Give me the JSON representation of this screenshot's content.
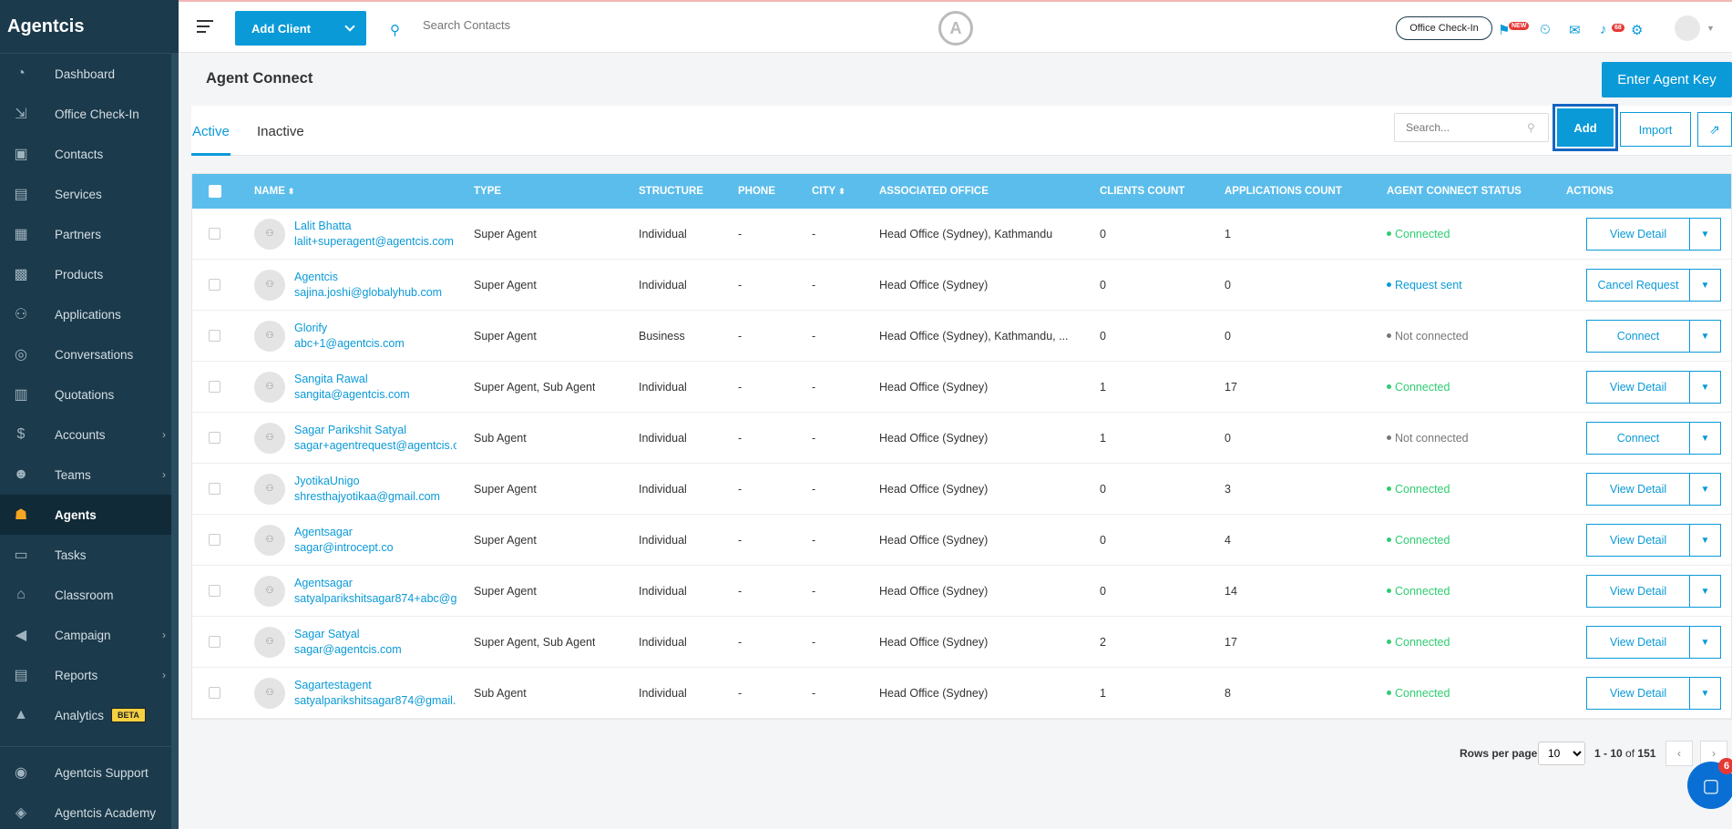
{
  "app": {
    "brand": "Agentcis"
  },
  "sidebar": {
    "items": [
      {
        "label": "Dashboard",
        "icon": "gauge-icon",
        "glyph": "◔"
      },
      {
        "label": "Office Check-In",
        "icon": "checkin-icon",
        "glyph": "⇲"
      },
      {
        "label": "Contacts",
        "icon": "contacts-icon",
        "glyph": "▣"
      },
      {
        "label": "Services",
        "icon": "services-icon",
        "glyph": "▤"
      },
      {
        "label": "Partners",
        "icon": "partners-icon",
        "glyph": "▦"
      },
      {
        "label": "Products",
        "icon": "products-icon",
        "glyph": "▩"
      },
      {
        "label": "Applications",
        "icon": "applications-icon",
        "glyph": "⚇"
      },
      {
        "label": "Conversations",
        "icon": "conversations-icon",
        "glyph": "◎"
      },
      {
        "label": "Quotations",
        "icon": "quotations-icon",
        "glyph": "▥"
      },
      {
        "label": "Accounts",
        "icon": "accounts-icon",
        "glyph": "$",
        "chevron": "›"
      },
      {
        "label": "Teams",
        "icon": "teams-icon",
        "glyph": "☻",
        "chevron": "›"
      },
      {
        "label": "Agents",
        "icon": "agents-icon",
        "glyph": "☗",
        "active": true
      },
      {
        "label": "Tasks",
        "icon": "tasks-icon",
        "glyph": "▭"
      },
      {
        "label": "Classroom",
        "icon": "classroom-icon",
        "glyph": "⌂"
      },
      {
        "label": "Campaign",
        "icon": "campaign-icon",
        "glyph": "◀",
        "chevron": "›"
      },
      {
        "label": "Reports",
        "icon": "reports-icon",
        "glyph": "▤",
        "chevron": "›"
      },
      {
        "label": "Analytics",
        "icon": "analytics-icon",
        "glyph": "▲",
        "badge": "BETA"
      }
    ],
    "bottom": [
      {
        "label": "Agentcis Support",
        "icon": "support-icon",
        "glyph": "◉"
      },
      {
        "label": "Agentcis Academy",
        "icon": "academy-icon",
        "glyph": "◈"
      }
    ]
  },
  "topbar": {
    "add_client": "Add Client",
    "search_placeholder": "Search Contacts",
    "office_checkin": "Office Check-In",
    "new_badge": "NEW",
    "notif_count": "68"
  },
  "page": {
    "title": "Agent Connect",
    "enter_agent_key": "Enter Agent Key",
    "tabs": [
      "Active",
      "Inactive"
    ],
    "search_placeholder": "Search...",
    "add": "Add",
    "import": "Import"
  },
  "table": {
    "headers": [
      "NAME",
      "TYPE",
      "STRUCTURE",
      "PHONE",
      "CITY",
      "ASSOCIATED OFFICE",
      "CLIENTS COUNT",
      "APPLICATIONS COUNT",
      "AGENT CONNECT STATUS",
      "ACTIONS"
    ],
    "sort_glyph": "⬍",
    "rows": [
      {
        "name": "Lalit Bhatta",
        "email": "lalit+superagent@agentcis.com",
        "type": "Super Agent",
        "structure": "Individual",
        "phone": "-",
        "city": "-",
        "office": "Head Office (Sydney), Kathmandu",
        "clients": "0",
        "applications": "1",
        "status": "Connected",
        "action": "View Detail"
      },
      {
        "name": "Agentcis",
        "email": "sajina.joshi@globalyhub.com",
        "type": "Super Agent",
        "structure": "Individual",
        "phone": "-",
        "city": "-",
        "office": "Head Office (Sydney)",
        "clients": "0",
        "applications": "0",
        "status": "Request sent",
        "action": "Cancel Request"
      },
      {
        "name": "Glorify",
        "email": "abc+1@agentcis.com",
        "type": "Super Agent",
        "structure": "Business",
        "phone": "-",
        "city": "-",
        "office": "Head Office (Sydney), Kathmandu, ...",
        "clients": "0",
        "applications": "0",
        "status": "Not connected",
        "action": "Connect"
      },
      {
        "name": "Sangita Rawal",
        "email": "sangita@agentcis.com",
        "type": "Super Agent, Sub Agent",
        "structure": "Individual",
        "phone": "-",
        "city": "-",
        "office": "Head Office (Sydney)",
        "clients": "1",
        "applications": "17",
        "status": "Connected",
        "action": "View Detail"
      },
      {
        "name": "Sagar Parikshit Satyal",
        "email": "sagar+agentrequest@agentcis.c",
        "type": "Sub Agent",
        "structure": "Individual",
        "phone": "-",
        "city": "-",
        "office": "Head Office (Sydney)",
        "clients": "1",
        "applications": "0",
        "status": "Not connected",
        "action": "Connect"
      },
      {
        "name": "JyotikaUnigo",
        "email": "shresthajyotikaa@gmail.com",
        "type": "Super Agent",
        "structure": "Individual",
        "phone": "-",
        "city": "-",
        "office": "Head Office (Sydney)",
        "clients": "0",
        "applications": "3",
        "status": "Connected",
        "action": "View Detail"
      },
      {
        "name": "Agentsagar",
        "email": "sagar@introcept.co",
        "type": "Super Agent",
        "structure": "Individual",
        "phone": "-",
        "city": "-",
        "office": "Head Office (Sydney)",
        "clients": "0",
        "applications": "4",
        "status": "Connected",
        "action": "View Detail"
      },
      {
        "name": "Agentsagar",
        "email": "satyalparikshitsagar874+abc@g",
        "type": "Super Agent",
        "structure": "Individual",
        "phone": "-",
        "city": "-",
        "office": "Head Office (Sydney)",
        "clients": "0",
        "applications": "14",
        "status": "Connected",
        "action": "View Detail"
      },
      {
        "name": "Sagar Satyal",
        "email": "sagar@agentcis.com",
        "type": "Super Agent, Sub Agent",
        "structure": "Individual",
        "phone": "-",
        "city": "-",
        "office": "Head Office (Sydney)",
        "clients": "2",
        "applications": "17",
        "status": "Connected",
        "action": "View Detail"
      },
      {
        "name": "Sagartestagent",
        "email": "satyalparikshitsagar874@gmail.",
        "type": "Sub Agent",
        "structure": "Individual",
        "phone": "-",
        "city": "-",
        "office": "Head Office (Sydney)",
        "clients": "1",
        "applications": "8",
        "status": "Connected",
        "action": "View Detail"
      }
    ]
  },
  "pagination": {
    "rows_per_page_label": "Rows per page",
    "rows_per_page": "10",
    "range": "1 - 10",
    "of_label": "of",
    "total": "151"
  },
  "chat": {
    "count": "6"
  },
  "colors": {
    "accent": "#0a9ad8",
    "connected": "#2ecc71",
    "request_sent": "#0a9ad8",
    "not_connected": "#777777",
    "sidebar": "#1b3a4b"
  }
}
